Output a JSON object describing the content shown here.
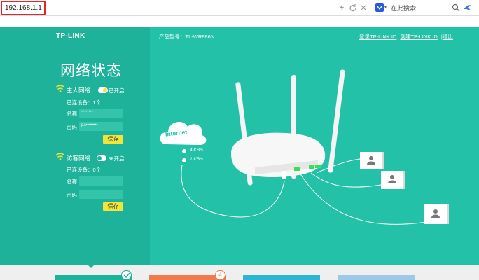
{
  "browser": {
    "url": "192.168.1.1",
    "search_placeholder": "在此搜索"
  },
  "sidebar": {
    "brand": "TP-LINK",
    "title": "网络状态",
    "host_network": {
      "label": "主人网络",
      "toggle_state": "已开启",
      "devices_label": "已连设备：",
      "devices_count": "1个",
      "name_label": "名称",
      "name_value": "••••••••",
      "password_label": "密码",
      "password_value": "pa••••••••",
      "save_label": "保存"
    },
    "guest_network": {
      "label": "访客网络",
      "toggle_state": "未开启",
      "devices_label": "已连设备：",
      "devices_count": "0个",
      "name_label": "名称",
      "password_label": "密码",
      "save_label": "保存"
    }
  },
  "header": {
    "model_label": "产品型号：TL-WR886N",
    "links": [
      "登录TP-LINK ID",
      "创建TP-LINK ID",
      "退出"
    ]
  },
  "diagram": {
    "internet_label": "Internet",
    "upload_speed": "4 KB/s",
    "download_speed": "1 KB/s"
  },
  "tabs": {
    "badge_count": "4"
  },
  "colors": {
    "sidebar_bg": "#1fb29a",
    "main_bg": "#22c1a8",
    "accent_yellow": "#f2e43b",
    "url_highlight": "#e3262a"
  }
}
